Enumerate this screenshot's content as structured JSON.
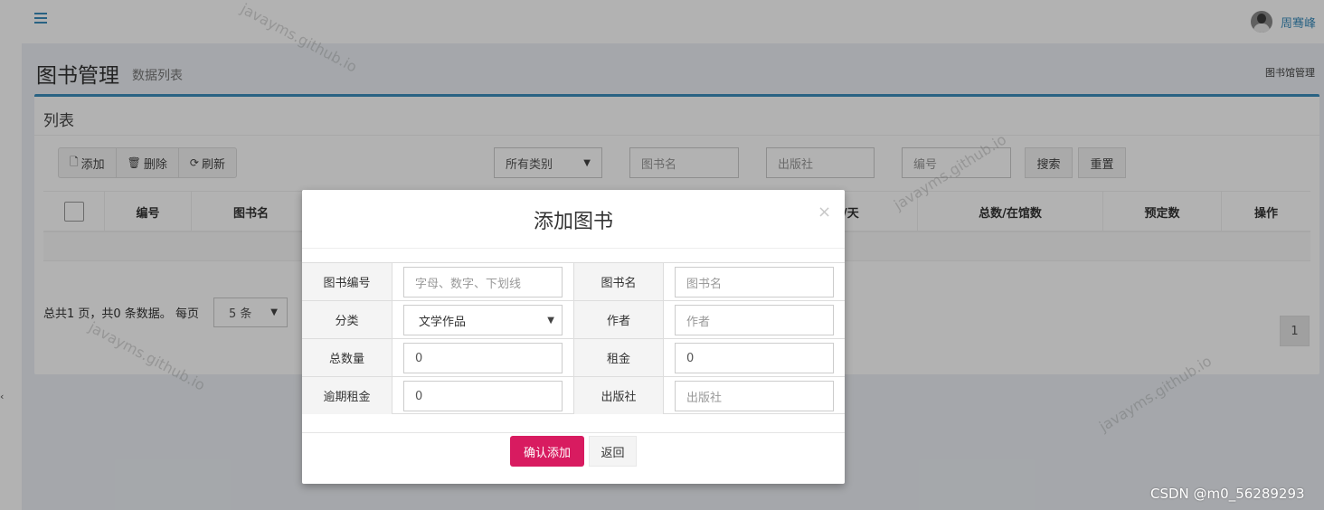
{
  "topbar": {
    "user_name": "周骞峰"
  },
  "header": {
    "title": "图书管理",
    "subtitle": "数据列表",
    "breadcrumb": "图书馆管理"
  },
  "panel": {
    "title": "列表",
    "toolbar": {
      "add": "添加",
      "delete": "删除",
      "refresh": "刷新"
    },
    "filters": {
      "category": "所有类别",
      "book_name_placeholder": "图书名",
      "publisher_placeholder": "出版社",
      "number_placeholder": "编号",
      "search": "搜索",
      "reset": "重置"
    },
    "columns": {
      "number": "编号",
      "book_name": "图书名",
      "per_day": "/天",
      "total": "总数/在馆数",
      "reserved": "预定数",
      "actions": "操作"
    },
    "pager": {
      "summary": "总共1 页，共0 条数据。 每页",
      "page_size": "5 条",
      "current_page": "1"
    }
  },
  "modal": {
    "title": "添加图书",
    "close": "×",
    "fields": {
      "book_no": {
        "label": "图书编号",
        "placeholder": "字母、数字、下划线"
      },
      "book_name": {
        "label": "图书名",
        "placeholder": "图书名"
      },
      "category": {
        "label": "分类",
        "value": "文学作品"
      },
      "author": {
        "label": "作者",
        "placeholder": "作者"
      },
      "total": {
        "label": "总数量",
        "value": "0"
      },
      "rent": {
        "label": "租金",
        "value": "0"
      },
      "overdue_rent": {
        "label": "逾期租金",
        "value": "0"
      },
      "publisher": {
        "label": "出版社",
        "placeholder": "出版社"
      }
    },
    "confirm": "确认添加",
    "back": "返回"
  },
  "watermark": "javayms.github.io",
  "footer_mark": "CSDN @m0_56289293",
  "icons": [
    "menu-icon",
    "file-icon",
    "trash-icon",
    "refresh-icon",
    "chevron-down-icon",
    "close-icon",
    "chevron-left-icon"
  ],
  "colors": {
    "primary": "#3c8dbc",
    "confirm": "#d81b60"
  }
}
